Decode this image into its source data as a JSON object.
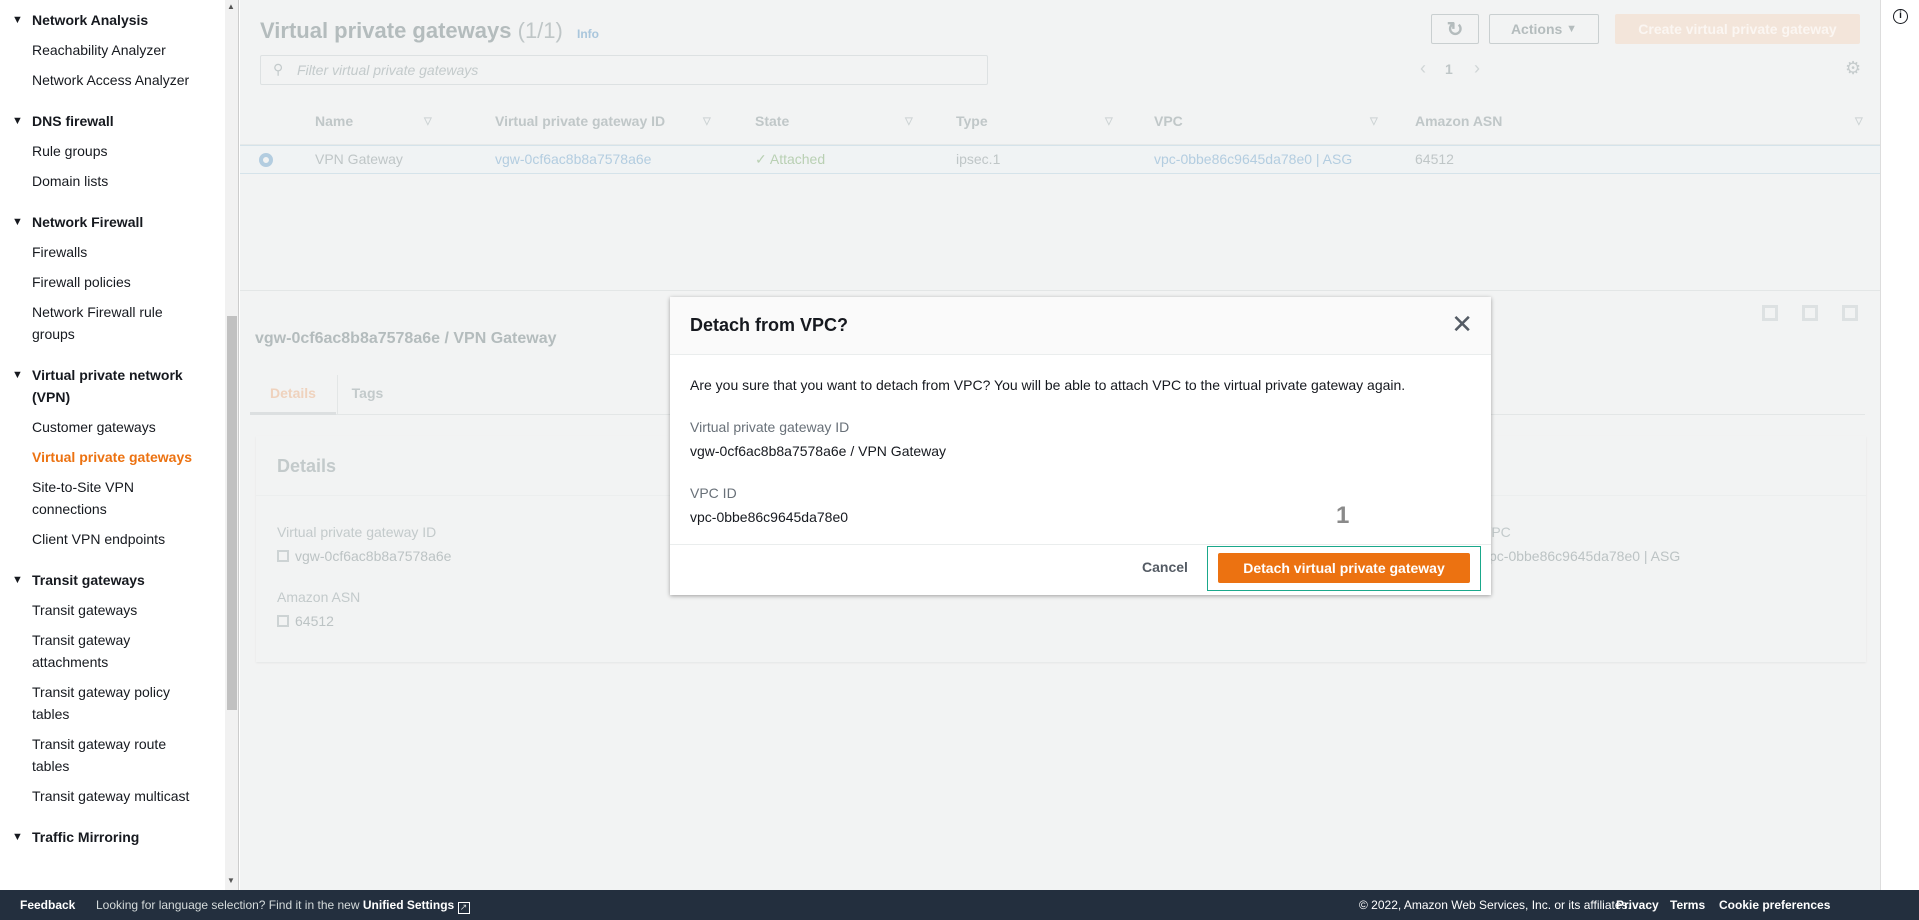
{
  "sidebar": {
    "groups": [
      {
        "title": "Network Analysis",
        "items": [
          "Reachability Analyzer",
          "Network Access Analyzer"
        ]
      },
      {
        "title": "DNS firewall",
        "items": [
          "Rule groups",
          "Domain lists"
        ]
      },
      {
        "title": "Network Firewall",
        "items": [
          "Firewalls",
          "Firewall policies",
          "Network Firewall rule groups"
        ]
      },
      {
        "title": "Virtual private network (VPN)",
        "items": [
          "Customer gateways",
          "Virtual private gateways",
          "Site-to-Site VPN connections",
          "Client VPN endpoints"
        ]
      },
      {
        "title": "Transit gateways",
        "items": [
          "Transit gateways",
          "Transit gateway attachments",
          "Transit gateway policy tables",
          "Transit gateway route tables",
          "Transit gateway multicast"
        ]
      },
      {
        "title": "Traffic Mirroring",
        "items": []
      }
    ],
    "active_item": "Virtual private gateways"
  },
  "main": {
    "title": "Virtual private gateways",
    "count": "(1/1)",
    "info": "Info",
    "actions_label": "Actions",
    "create_label": "Create virtual private gateway",
    "filter_placeholder": "Filter virtual private gateways",
    "page": "1",
    "columns": [
      "Name",
      "Virtual private gateway ID",
      "State",
      "Type",
      "VPC",
      "Amazon ASN"
    ],
    "rows": [
      {
        "name": "VPN Gateway",
        "id": "vgw-0cf6ac8b8a7578a6e",
        "state": "Attached",
        "type": "ipsec.1",
        "vpc": "vpc-0bbe86c9645da78e0 | ASG",
        "asn": "64512",
        "selected": true
      }
    ]
  },
  "details": {
    "header": "vgw-0cf6ac8b8a7578a6e / VPN Gateway",
    "tabs": [
      "Details",
      "Tags"
    ],
    "active_tab": "Details",
    "card_title": "Details",
    "fields": {
      "vgw_label": "Virtual private gateway ID",
      "vgw_value": "vgw-0cf6ac8b8a7578a6e",
      "asn_label": "Amazon ASN",
      "asn_value": "64512",
      "vpc_label": "VPC",
      "vpc_value": "vpc-0bbe86c9645da78e0 | ASG"
    }
  },
  "modal": {
    "title": "Detach from VPC?",
    "message": "Are you sure that you want to detach from VPC? You will be able to attach VPC to the virtual private gateway again.",
    "vgw_label": "Virtual private gateway ID",
    "vgw_value": "vgw-0cf6ac8b8a7578a6e / VPN Gateway",
    "vpc_label": "VPC ID",
    "vpc_value": "vpc-0bbe86c9645da78e0",
    "cancel_label": "Cancel",
    "confirm_label": "Detach virtual private gateway",
    "annotation": "1"
  },
  "footer": {
    "feedback": "Feedback",
    "language_msg": "Looking for language selection? Find it in the new",
    "unified_settings": "Unified Settings",
    "copyright": "© 2022, Amazon Web Services, Inc. or its affiliates.",
    "privacy": "Privacy",
    "terms": "Terms",
    "cookies": "Cookie preferences"
  },
  "colors": {
    "accent": "#ec7211",
    "footer_bg": "#232f3e",
    "focus_ring": "#1aa88b",
    "link": "#0073bb"
  }
}
